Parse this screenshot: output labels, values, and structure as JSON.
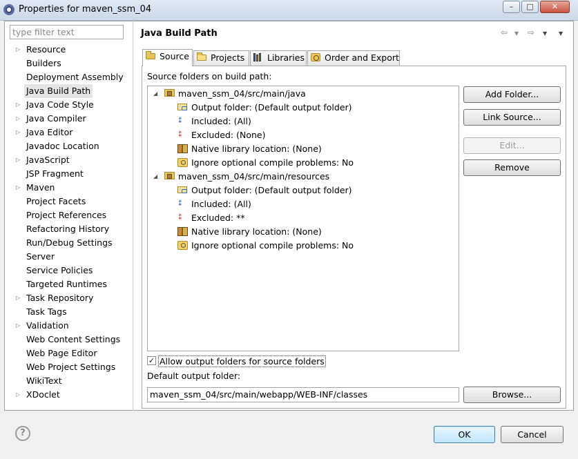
{
  "window": {
    "title": "Properties for maven_ssm_04",
    "controls": {
      "minimize": "–",
      "maximize": "□",
      "close": "✕"
    }
  },
  "filter": {
    "placeholder": "type filter text"
  },
  "nav_tree": [
    {
      "label": "Resource",
      "expandable": true
    },
    {
      "label": "Builders",
      "expandable": false
    },
    {
      "label": "Deployment Assembly",
      "expandable": false
    },
    {
      "label": "Java Build Path",
      "expandable": false,
      "selected": true
    },
    {
      "label": "Java Code Style",
      "expandable": true
    },
    {
      "label": "Java Compiler",
      "expandable": true
    },
    {
      "label": "Java Editor",
      "expandable": true
    },
    {
      "label": "Javadoc Location",
      "expandable": false
    },
    {
      "label": "JavaScript",
      "expandable": true
    },
    {
      "label": "JSP Fragment",
      "expandable": false
    },
    {
      "label": "Maven",
      "expandable": true
    },
    {
      "label": "Project Facets",
      "expandable": false
    },
    {
      "label": "Project References",
      "expandable": false
    },
    {
      "label": "Refactoring History",
      "expandable": false
    },
    {
      "label": "Run/Debug Settings",
      "expandable": false
    },
    {
      "label": "Server",
      "expandable": false
    },
    {
      "label": "Service Policies",
      "expandable": false
    },
    {
      "label": "Targeted Runtimes",
      "expandable": false
    },
    {
      "label": "Task Repository",
      "expandable": true
    },
    {
      "label": "Task Tags",
      "expandable": false
    },
    {
      "label": "Validation",
      "expandable": true
    },
    {
      "label": "Web Content Settings",
      "expandable": false
    },
    {
      "label": "Web Page Editor",
      "expandable": false
    },
    {
      "label": "Web Project Settings",
      "expandable": false
    },
    {
      "label": "WikiText",
      "expandable": false
    },
    {
      "label": "XDoclet",
      "expandable": true
    }
  ],
  "page": {
    "title": "Java Build Path"
  },
  "tabs": [
    {
      "label": "Source",
      "icon": "source-folder-icon",
      "active": true
    },
    {
      "label": "Projects",
      "icon": "project-folder-icon",
      "active": false
    },
    {
      "label": "Libraries",
      "icon": "libraries-icon",
      "active": false
    },
    {
      "label": "Order and Export",
      "icon": "order-export-icon",
      "active": false
    }
  ],
  "source_tab": {
    "caption": "Source folders on build path:",
    "folders": [
      {
        "name": "maven_ssm_04/src/main/java",
        "children": [
          {
            "text": "Output folder: (Default output folder)",
            "icon": "output-folder-icon"
          },
          {
            "text": "Included: (All)",
            "icon": "included-filter-icon"
          },
          {
            "text": "Excluded: (None)",
            "icon": "excluded-filter-icon"
          },
          {
            "text": "Native library location: (None)",
            "icon": "native-library-icon"
          },
          {
            "text": "Ignore optional compile problems: No",
            "icon": "ignore-problems-icon"
          }
        ]
      },
      {
        "name": "maven_ssm_04/src/main/resources",
        "children": [
          {
            "text": "Output folder: (Default output folder)",
            "icon": "output-folder-icon"
          },
          {
            "text": "Included: (All)",
            "icon": "included-filter-icon"
          },
          {
            "text": "Excluded: **",
            "icon": "excluded-filter-icon"
          },
          {
            "text": "Native library location: (None)",
            "icon": "native-library-icon"
          },
          {
            "text": "Ignore optional compile problems: No",
            "icon": "ignore-problems-icon"
          }
        ]
      }
    ],
    "buttons": {
      "add_folder": "Add Folder...",
      "link_source": "Link Source...",
      "edit": "Edit...",
      "remove": "Remove"
    },
    "allow_output_checkbox": {
      "label": "Allow output folders for source folders",
      "checked": true
    },
    "default_output_label": "Default output folder:",
    "default_output_value": "maven_ssm_04/src/main/webapp/WEB-INF/classes",
    "browse": "Browse..."
  },
  "footer": {
    "help": "?",
    "ok": "OK",
    "cancel": "Cancel"
  }
}
